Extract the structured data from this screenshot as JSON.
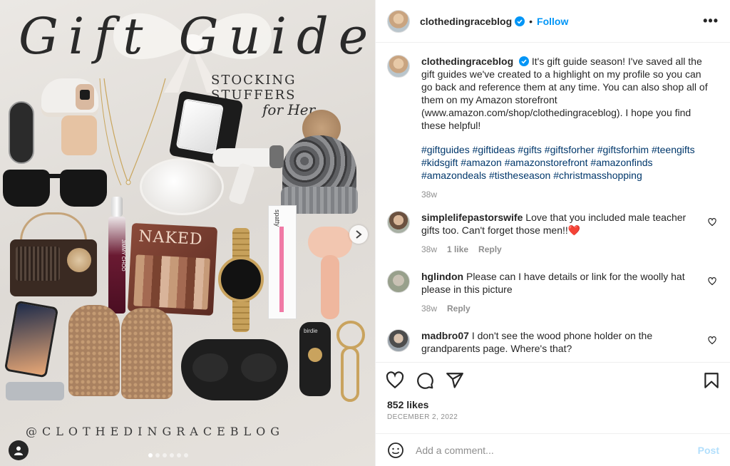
{
  "media": {
    "title": "Gift Guide",
    "subtitle": "STOCKING STUFFERS",
    "subtitle2": "for Her",
    "handle": "@CLOTHEDINGRACEBLOG",
    "product_labels": {
      "palette": "NAKED",
      "perfume": "JIMMY CHOO",
      "brush": "spatty",
      "alarm": "birdie"
    }
  },
  "header": {
    "username": "clothedingraceblog",
    "separator": "•",
    "follow_label": "Follow",
    "more_label": "•••"
  },
  "caption": {
    "username": "clothedingraceblog",
    "text": "It's gift guide season! I've saved all the gift guides we've created to a highlight on my profile so you can go back and reference them at any time. You can also shop all of them on my Amazon storefront (www.amazon.com/shop/clothedingraceblog). I hope you find these helpful!",
    "hashtags": "#giftguides #giftideas #gifts #giftsforher #giftsforhim #teengifts #kidsgift #amazon #amazonstorefront #amazonfinds #amazondeals #tistheseason #christmasshopping",
    "time": "38w"
  },
  "comments": [
    {
      "username": "simplelifepastorswife",
      "text": "Love that you included male teacher gifts too. Can't forget those men!!❤️",
      "time": "38w",
      "likes": "1 like",
      "reply": "Reply"
    },
    {
      "username": "hglindon",
      "text": "Please can I have details or link for the woolly hat please in this picture",
      "time": "38w",
      "reply": "Reply"
    },
    {
      "username": "madbro07",
      "text": "I don't see the wood phone holder on the grandparents page. Where's that?"
    }
  ],
  "likes": "852 likes",
  "date": "DECEMBER 2, 2022",
  "comment_box": {
    "placeholder": "Add a comment...",
    "post_label": "Post"
  },
  "colors": {
    "link_blue": "#0095f6",
    "hashtag": "#00376b",
    "muted": "#8e8e8e"
  }
}
